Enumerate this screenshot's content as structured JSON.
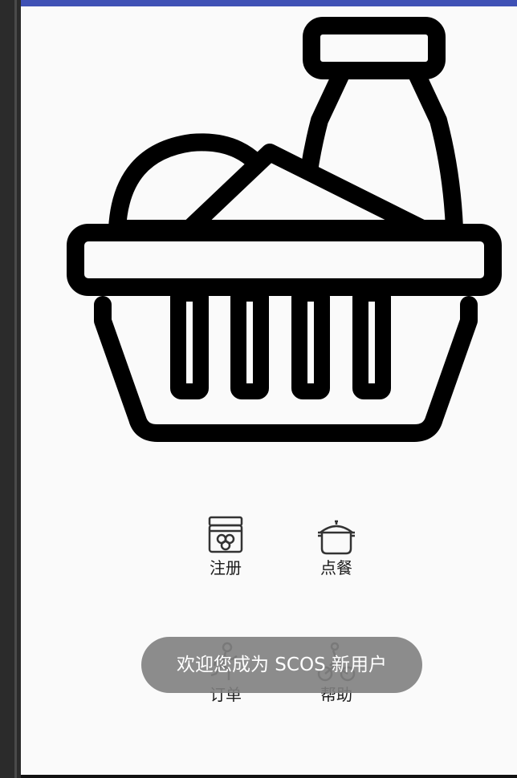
{
  "app": {
    "hero_image": "grocery-basket-with-bottle-icon",
    "menu": [
      {
        "label": "注册",
        "icon": "honey-jar-icon"
      },
      {
        "label": "点餐",
        "icon": "cooking-pot-icon"
      },
      {
        "label": "订单",
        "icon": "running-person-icon"
      },
      {
        "label": "帮助",
        "icon": "bicycle-icon"
      }
    ]
  },
  "toast": {
    "message": "欢迎您成为 SCOS 新用户"
  },
  "colors": {
    "status_bar": "#3f51b5",
    "background": "#fafafa",
    "toast": "#808080"
  }
}
